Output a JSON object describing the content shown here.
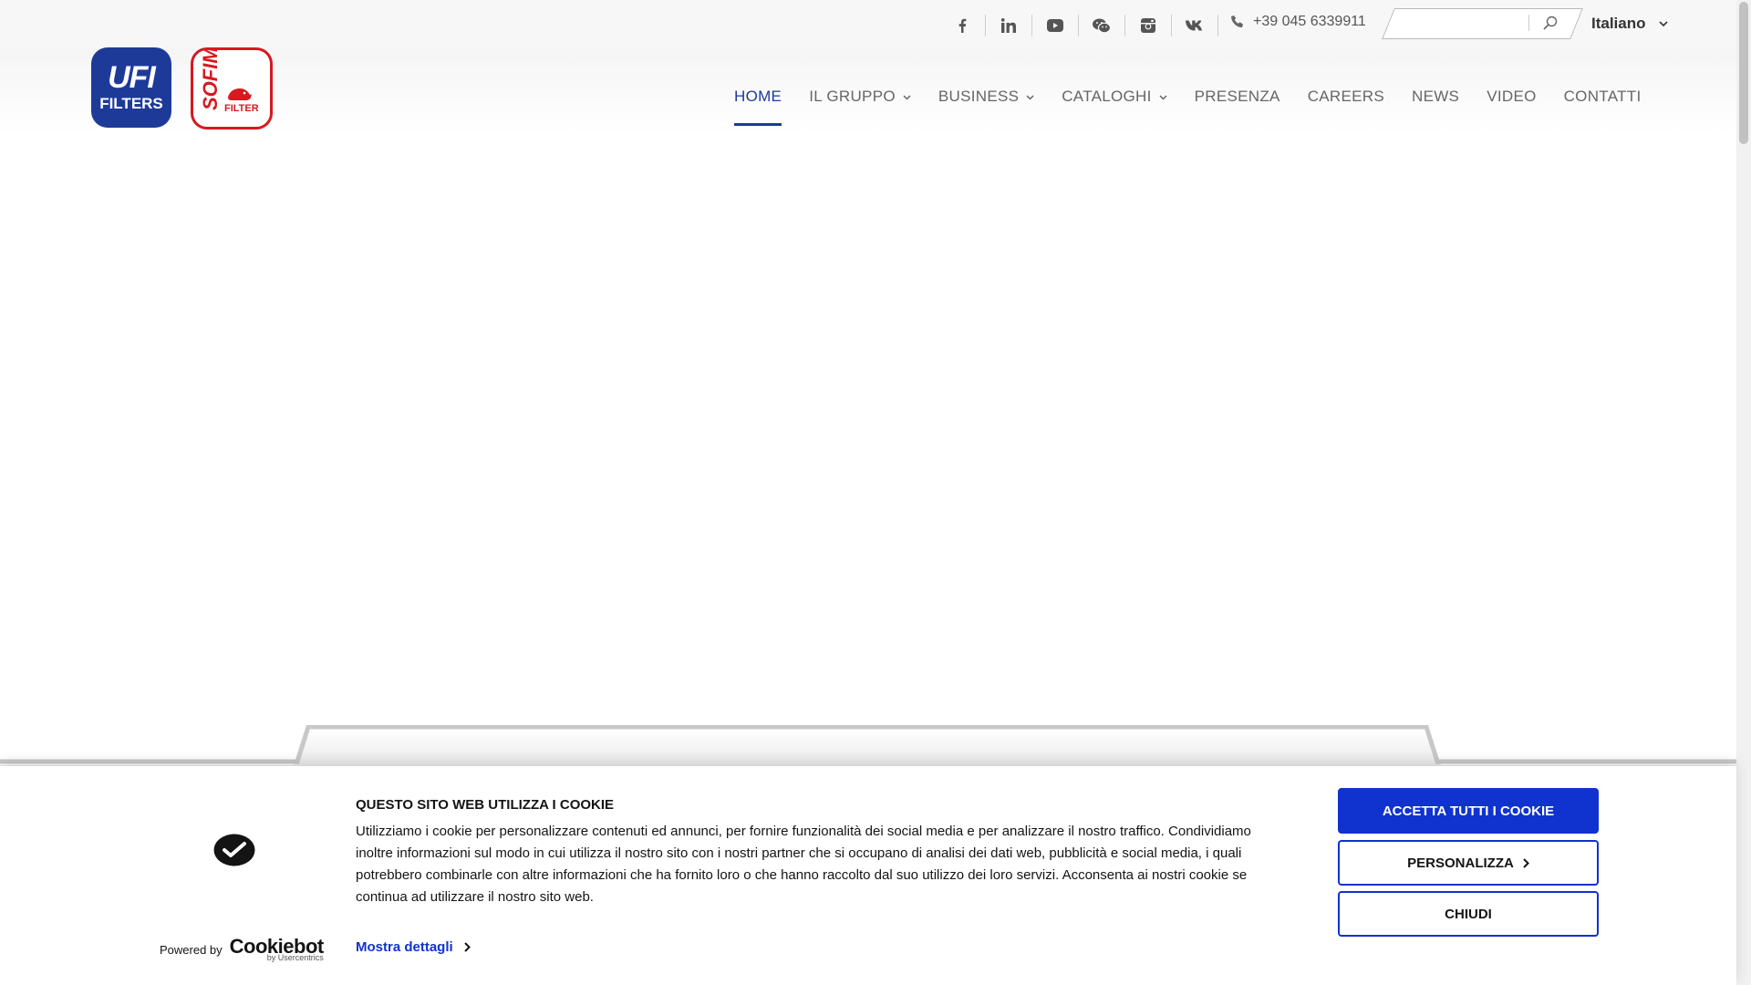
{
  "topbar": {
    "social": [
      {
        "name": "facebook-icon"
      },
      {
        "name": "linkedin-icon"
      },
      {
        "name": "youtube-icon"
      },
      {
        "name": "wechat-icon"
      },
      {
        "name": "instagram-icon"
      },
      {
        "name": "vk-icon"
      }
    ],
    "phone": "+39 045 6339911",
    "search": {
      "value": "",
      "placeholder": ""
    },
    "language": "Italiano"
  },
  "logos": {
    "ufi_line1": "UFI",
    "ufi_line2": "FILTERS",
    "sofima_word": "SOFIMA",
    "sofima_sub": "FILTER"
  },
  "nav": {
    "items": [
      {
        "label": "HOME",
        "active": true,
        "dropdown": false
      },
      {
        "label": "IL GRUPPO",
        "dropdown": true
      },
      {
        "label": "BUSINESS",
        "dropdown": true
      },
      {
        "label": "CATALOGHI",
        "dropdown": true
      },
      {
        "label": "PRESENZA",
        "dropdown": false
      },
      {
        "label": "CAREERS",
        "dropdown": false
      },
      {
        "label": "NEWS",
        "dropdown": false
      },
      {
        "label": "VIDEO",
        "dropdown": false
      },
      {
        "label": "CONTATTI",
        "dropdown": false
      }
    ]
  },
  "cookie": {
    "title": "QUESTO SITO WEB UTILIZZA I COOKIE",
    "text": "Utilizziamo i cookie per personalizzare contenuti ed annunci, per fornire funzionalità dei social media e per analizzare il nostro traffico. Condividiamo inoltre informazioni sul modo in cui utilizza il nostro sito con i nostri partner che si occupano di analisi dei dati web, pubblicità e social media, i quali potrebbero combinarle con altre informazioni che ha fornito loro o che hanno raccolto dal suo utilizzo dei loro servizi. Acconsenta ai nostri cookie se continua ad utilizzare il nostro sito web.",
    "details_label": "Mostra dettagli",
    "powered_by": "Powered by",
    "brand": "Cookiebot",
    "brand_sub": "by Usercentrics",
    "accept_label": "ACCETTA TUTTI I COOKIE",
    "customize_label": "PERSONALIZZA",
    "close_label": "CHIUDI"
  },
  "colors": {
    "brand_blue": "#1e3a99",
    "sofima_red": "#d71920",
    "cookiebot_blue": "#1032cf"
  }
}
